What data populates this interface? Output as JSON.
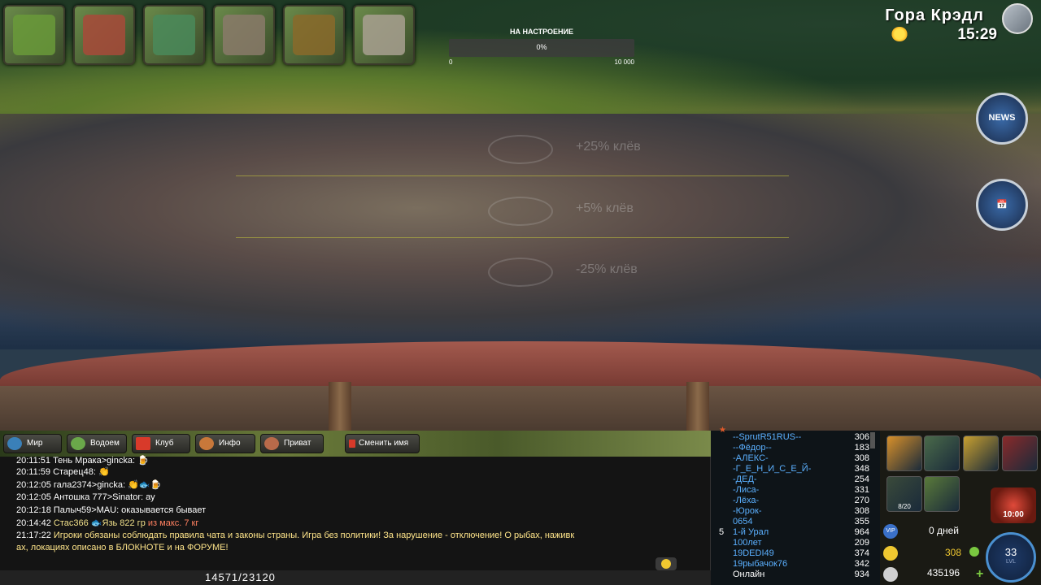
{
  "top_tiles": [
    {
      "name": "fishing-gear-tile",
      "color": "#6a9a3a"
    },
    {
      "name": "character-tile",
      "color": "#a84a3a"
    },
    {
      "name": "map-tile",
      "color": "#4a8a5a"
    },
    {
      "name": "kitchen-pot-tile",
      "color": "#8a7a6a"
    },
    {
      "name": "treasure-tile",
      "color": "#8a6a2a"
    },
    {
      "name": "newspaper-tile",
      "color": "#a8a090"
    }
  ],
  "mood": {
    "title": "НА НАСТРОЕНИЕ",
    "percent_label": "0%",
    "min_label": "0",
    "max_label": "10 000",
    "fill_fraction": 0
  },
  "location": {
    "name": "Гора Крэдл",
    "time": "15:29"
  },
  "depth_zones": [
    {
      "label": "+25% клёв"
    },
    {
      "label": "+5% клёв"
    },
    {
      "label": "-25% клёв"
    }
  ],
  "chat_tabs": [
    "Мир",
    "Водоем",
    "Клуб",
    "Инфо",
    "Приват",
    "Сменить имя"
  ],
  "chat": {
    "lines": [
      {
        "time": "20:11:51",
        "text": "Тень Мрака>gincka:",
        "emoji": " 🍺"
      },
      {
        "time": "20:11:59",
        "text": "Старец48:",
        "emoji": " 👏"
      },
      {
        "time": "20:12:05",
        "text": "гала2374>gincka:",
        "emoji": " 👏🐟🍺"
      },
      {
        "time": "20:12:05",
        "text": "Антошка 777>Sinator: ау",
        "emoji": ""
      },
      {
        "time": "20:12:18",
        "text": "Палыч59>MAU: оказывается бывает",
        "emoji": ""
      },
      {
        "time": "20:14:42",
        "text": "Стас366",
        "hl1": "Язь 822 гр",
        "hl2": "из макс. 7 кг"
      },
      {
        "time": "21:17:22",
        "sys": "Игроки обязаны соблюдать правила чата и законы страны. Игра без политики! За нарушение - отключение! О рыбах, наживк",
        "sys2": "ах, локациях описано в БЛОКНОТЕ и на ФОРУМЕ!"
      }
    ],
    "counter": "14571/23120"
  },
  "players": [
    {
      "name": "--SprutR51RUS--",
      "value": "306"
    },
    {
      "name": "--Фёдор--",
      "value": "183"
    },
    {
      "name": "-АЛЕКС-",
      "value": "308"
    },
    {
      "name": "-Г_Е_Н_И_С_Е_Й-",
      "value": "348"
    },
    {
      "name": "-ДЕД-",
      "value": "254"
    },
    {
      "name": "-Лиса-",
      "value": "331"
    },
    {
      "name": "-Лёха-",
      "value": "270"
    },
    {
      "name": "-Юрок-",
      "value": "308"
    },
    {
      "name": "0654",
      "value": "355"
    },
    {
      "name": "1-й Урал",
      "value": "964",
      "rank": "5"
    },
    {
      "name": "100лет",
      "value": "209"
    },
    {
      "name": "19DEDI49",
      "value": "374"
    },
    {
      "name": "19рыбачок76",
      "value": "342"
    },
    {
      "name": "Онлайн",
      "value": "934"
    }
  ],
  "inventory": [
    {
      "name": "crate-item",
      "label": ""
    },
    {
      "name": "fisherman-item",
      "label": ""
    },
    {
      "name": "backpack-item",
      "label": ""
    },
    {
      "name": "crossed-swords-item",
      "label": ""
    },
    {
      "name": "bait-item",
      "label": "8/20"
    },
    {
      "name": "notebook-item",
      "label": ""
    }
  ],
  "stats": {
    "vip_days": "0 дней",
    "coins": "308",
    "silver": "435196",
    "level": "33",
    "level_label": "LVL",
    "timer": "10:00"
  },
  "colors": {
    "accent": "#5bb0ff",
    "gold": "#f0c830"
  }
}
